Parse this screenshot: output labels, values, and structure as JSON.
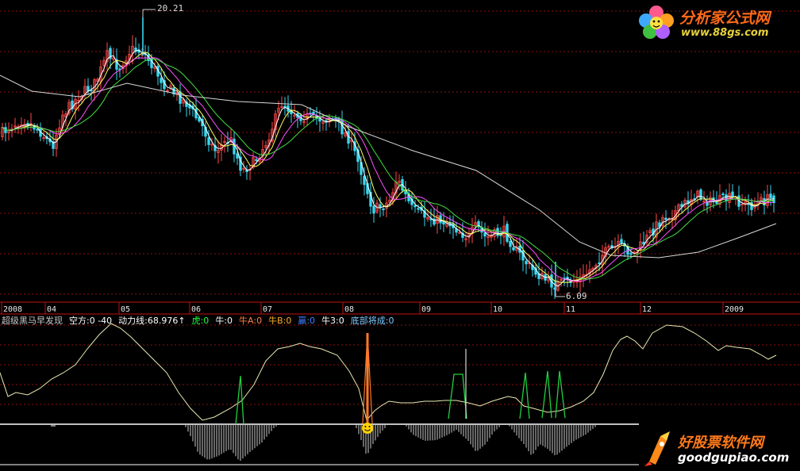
{
  "chart_data": [
    {
      "type": "candlestick",
      "title": "",
      "x_tick_labels": [
        "2008",
        "04",
        "05",
        "06",
        "07",
        "08",
        "09",
        "10",
        "11",
        "12",
        "2009"
      ],
      "annotations": {
        "high_label": "20.21",
        "low_label": "6.09"
      },
      "colors": {
        "up": "#ff4848",
        "down": "#38d8f0",
        "ma5": "#ffffff",
        "ma10": "#ffff60",
        "ma20": "#ff50ff",
        "ma30": "#40e040",
        "ma60": "#d8d8d8"
      },
      "grid": "dotted-horizontal"
    },
    {
      "type": "line",
      "legend": [
        {
          "text": "超级黑马早发现",
          "color": "#c8c8c8"
        },
        {
          "text": "空方:0 -40",
          "color": "#ffffff"
        },
        {
          "text": "动力线:68.976↑",
          "color": "#ffffff"
        },
        {
          "text": "虎:0",
          "color": "#20ff40"
        },
        {
          "text": "牛:0",
          "color": "#ffffff"
        },
        {
          "text": "牛A:0",
          "color": "#ff8040"
        },
        {
          "text": "牛B:0",
          "color": "#ffb020"
        },
        {
          "text": "赢:0",
          "color": "#4080ff"
        },
        {
          "text": "牛3:0",
          "color": "#ffffff"
        },
        {
          "text": "底部将成:0",
          "color": "#80c8ff"
        }
      ],
      "colors": {
        "line": "#e8e8b0",
        "green": "#20d040",
        "orange": "#ff7a28",
        "fill": "#ffffff"
      }
    }
  ],
  "watermarks": {
    "top_title": "分析家公式网",
    "top_url": "www.88gs.com",
    "bottom_title": "好股票软件网",
    "bottom_url": "goodgupiao.com"
  }
}
